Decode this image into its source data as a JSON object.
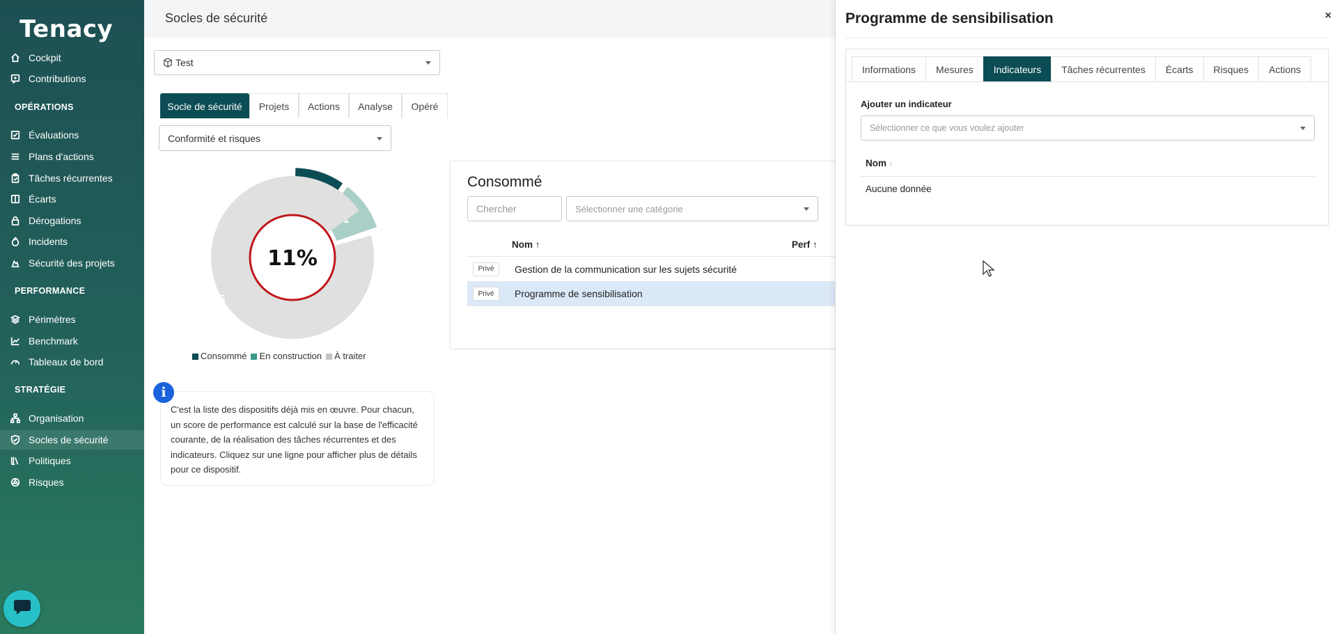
{
  "sidebar": {
    "logo": "Tenacy",
    "items": [
      {
        "label": "Cockpit",
        "icon": "home-icon"
      },
      {
        "label": "Contributions",
        "icon": "contribution-icon"
      },
      {
        "label": "Évaluations",
        "icon": "check-square-icon"
      },
      {
        "label": "Plans d'actions",
        "icon": "list-icon"
      },
      {
        "label": "Tâches récurrentes",
        "icon": "clipboard-icon"
      },
      {
        "label": "Écarts",
        "icon": "gap-icon"
      },
      {
        "label": "Dérogations",
        "icon": "lock-icon"
      },
      {
        "label": "Incidents",
        "icon": "fire-icon"
      },
      {
        "label": "Sécurité des projets",
        "icon": "project-security-icon"
      },
      {
        "label": "Périmètres",
        "icon": "layers-icon"
      },
      {
        "label": "Benchmark",
        "icon": "chart-line-icon"
      },
      {
        "label": "Tableaux de bord",
        "icon": "gauge-icon"
      },
      {
        "label": "Organisation",
        "icon": "org-chart-icon"
      },
      {
        "label": "Socles de sécurité",
        "icon": "shield-check-icon"
      },
      {
        "label": "Politiques",
        "icon": "books-icon"
      },
      {
        "label": "Risques",
        "icon": "risk-icon"
      }
    ],
    "sections": [
      "OPÉRATIONS",
      "PERFORMANCE",
      "STRATÉGIE"
    ],
    "active": "Socles de sécurité"
  },
  "header": {
    "title": "Socles de sécurité"
  },
  "main": {
    "socle_select": "Test",
    "tabs": [
      "Socle de sécurité",
      "Projets",
      "Actions",
      "Analyse",
      "Opéré"
    ],
    "active_tab": "Socle de sécurité",
    "view_select": "Conformité et risques",
    "legend": [
      "Consommé",
      "En construction",
      "À traiter"
    ],
    "info_text": "C'est la liste des dispositifs déjà mis en œuvre. Pour chacun, un score de performance est calculé sur la base de l'efficacité courante, de la réalisation des tâches récurrentes et des indicateurs. Cliquez sur une ligne pour afficher plus de détails pour ce dispositif.",
    "info_badge": "i"
  },
  "chart_data": {
    "type": "pie",
    "categories": [
      "Consommé",
      "En construction",
      "À traiter"
    ],
    "values": [
      2,
      1,
      65
    ],
    "center_label": "11%",
    "colors": [
      "#0c4c54",
      "#a9cfc6",
      "#e0e0e0"
    ]
  },
  "card": {
    "title": "Consommé",
    "search_placeholder": "Chercher",
    "category_placeholder": "Sélectionner une catégorie",
    "columns": [
      "Nom ↑",
      "Perf ↑"
    ],
    "rows": [
      {
        "badge": "Privé",
        "name": "Gestion de la communication sur les sujets sécurité"
      },
      {
        "badge": "Privé",
        "name": "Programme de sensibilisation"
      }
    ]
  },
  "panel": {
    "title": "Programme de sensibilisation",
    "close": "×",
    "tabs": [
      "Informations",
      "Mesures",
      "Indicateurs",
      "Tâches récurrentes",
      "Écarts",
      "Risques",
      "Actions"
    ],
    "active_tab": "Indicateurs",
    "add_label": "Ajouter un indicateur",
    "add_placeholder": "Sélectionner ce que vous voulez ajouter",
    "col_name": "Nom",
    "sort_arrow": "↑",
    "empty": "Aucune donnée"
  },
  "colors": {
    "accent": "#0c4c54",
    "selected_row": "#dbe8f8",
    "info": "#1a63dc",
    "progress_ring": "#c0161a"
  }
}
